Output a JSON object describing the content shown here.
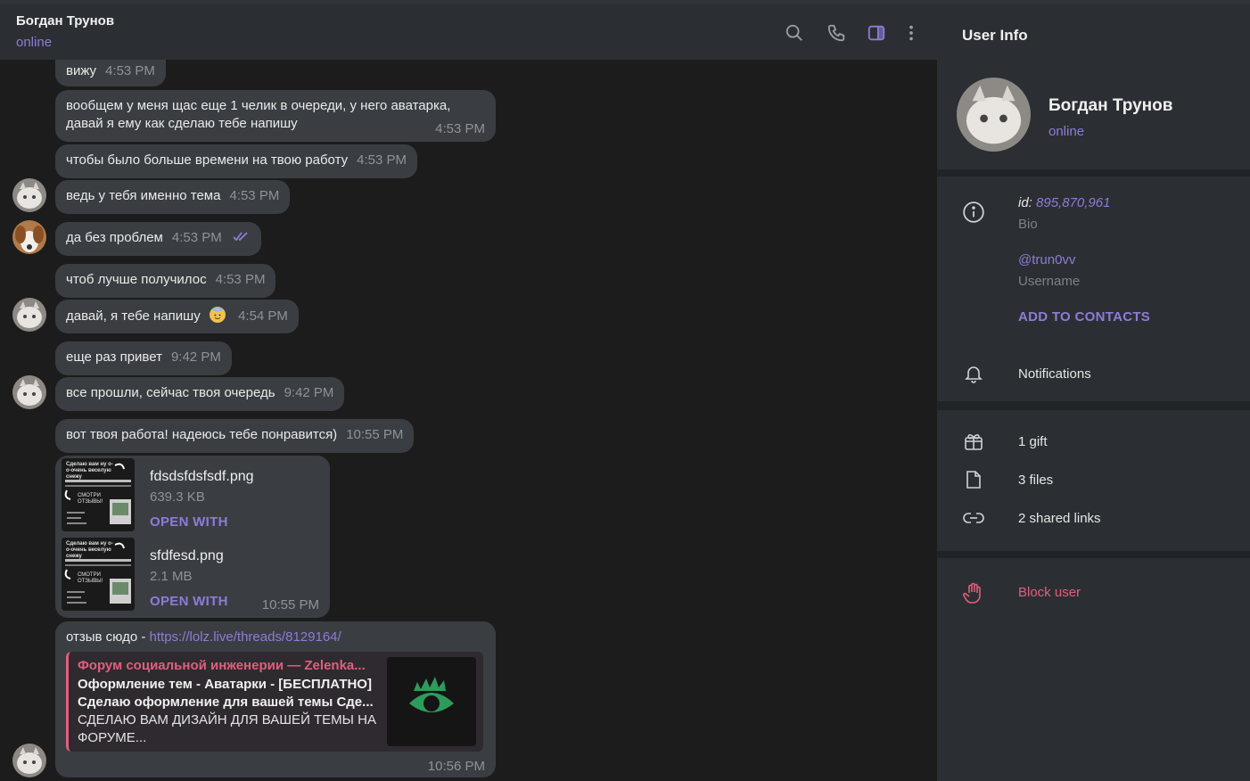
{
  "chat": {
    "peer_name": "Богдан Трунов",
    "peer_status": "online",
    "messages": [
      {
        "text": "вижу",
        "time": "4:53 PM"
      },
      {
        "line1": "вообщем у меня щас еще 1 челик в очереди, у него аватарка,",
        "line2": "давай я ему как сделаю тебе напишу",
        "time": "4:53 PM"
      },
      {
        "text": "чтобы было больше времени на твою работу",
        "time": "4:53 PM"
      },
      {
        "text": "ведь у тебя именно тема",
        "time": "4:53 PM"
      },
      {
        "text": "да без проблем",
        "time": "4:53 PM"
      },
      {
        "text": "чтоб лучше получилос",
        "time": "4:53 PM"
      },
      {
        "text": "давай, я тебе напишу",
        "time": "4:54 PM"
      },
      {
        "text": "еще раз привет",
        "time": "9:42 PM"
      },
      {
        "text": "все прошли, сейчас твоя очередь",
        "time": "9:42 PM"
      },
      {
        "text": "вот твоя работа! надеюсь тебе понравится)",
        "time": "10:55 PM"
      },
      {
        "time": "10:55 PM"
      },
      {
        "text": "отзыв сюдо - ",
        "link": "https://lolz.live/threads/8129164/",
        "time": "10:56 PM"
      }
    ],
    "files": [
      {
        "name": "fdsdsfdsfsdf.png",
        "size": "639.3 KB",
        "action": "OPEN WITH"
      },
      {
        "name": "sfdfesd.png",
        "size": "2.1 MB",
        "action": "OPEN WITH"
      }
    ],
    "preview": {
      "site": "Форум социальной инженерии — Zelenka...",
      "title_line1": "Оформление тем - Аватарки - [БЕСПЛАТНО]",
      "title_line2": "Сделаю оформление для вашей темы Сде...",
      "desc_line1": "СДЕЛАЮ ВАМ ДИЗАЙН ДЛЯ ВАШЕЙ ТЕМЫ НА",
      "desc_line2": "ФОРУМЕ..."
    },
    "thumb_text": {
      "top": "Сделаю вам ну о-о-очень веселую снежу",
      "side": "СМОТРИ ОТЗЫВЫ!"
    }
  },
  "header_icons": [
    "search-icon",
    "phone-icon",
    "sidebar-toggle-icon",
    "more-vertical-icon"
  ],
  "sidebar": {
    "title": "User Info",
    "name": "Богдан Трунов",
    "status": "online",
    "id_label": "id:",
    "id_value": "895,870,961",
    "bio_label": "Bio",
    "username": "@trun0vv",
    "username_label": "Username",
    "add_contact": "ADD TO CONTACTS",
    "notifications": "Notifications",
    "gifts": "1 gift",
    "files": "3 files",
    "links": "2 shared links",
    "block": "Block user"
  },
  "colors": {
    "accent": "#8e7bd8",
    "danger": "#e25e7c",
    "bubble": "#3a3e42",
    "chat_bg": "#1c1c1c",
    "panel": "#2b2f33"
  }
}
